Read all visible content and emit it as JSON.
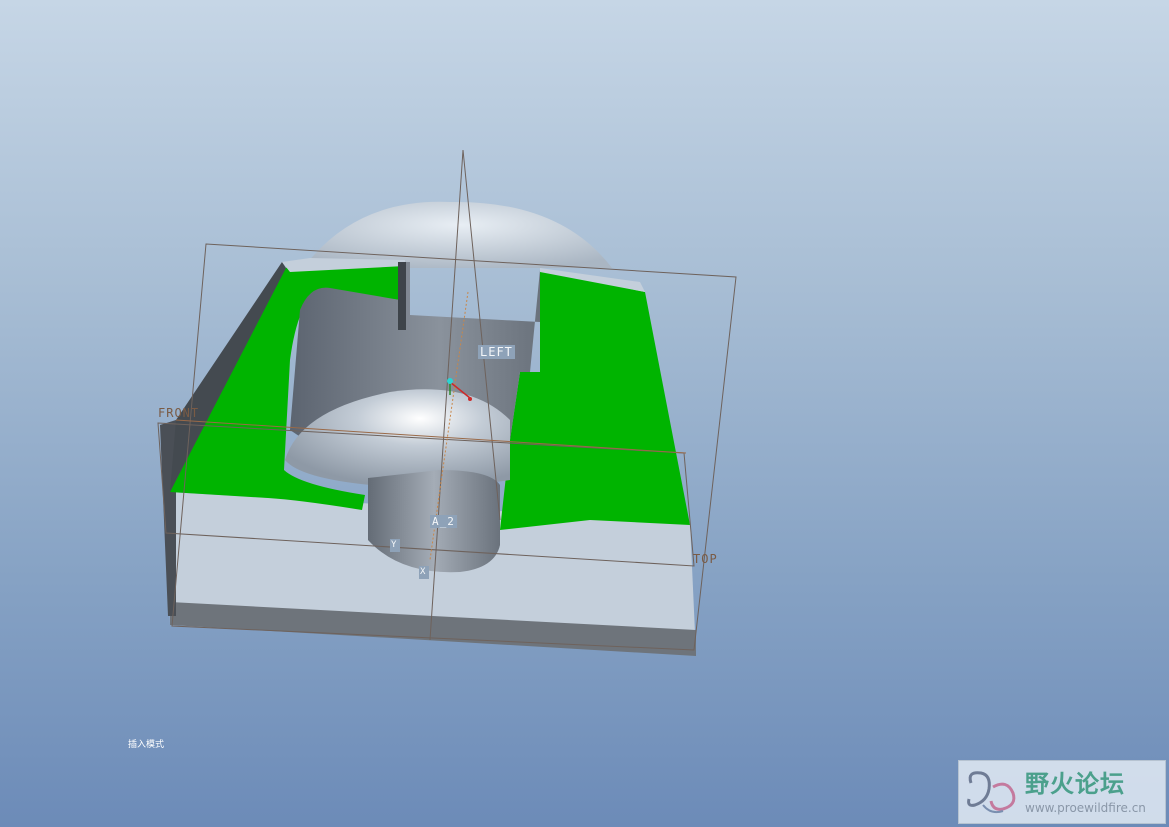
{
  "viewport": {
    "datum_planes": [
      "FRONT",
      "LEFT",
      "TOP"
    ],
    "axis_label": "A_2",
    "csys_labels": [
      "Y",
      "X"
    ]
  },
  "status_text": "插入模式",
  "watermark": {
    "title": "野火论坛",
    "url": "www.proewildfire.cn"
  },
  "colors": {
    "highlight_surface": "#00b400",
    "model_body": "#c4cfdb",
    "datum_plane": "#6e625c",
    "background_top": "#c6d6e6",
    "background_bottom": "#6c8bb8"
  },
  "icons": [
    "watermark-logo-icon",
    "csys-origin-icon"
  ]
}
